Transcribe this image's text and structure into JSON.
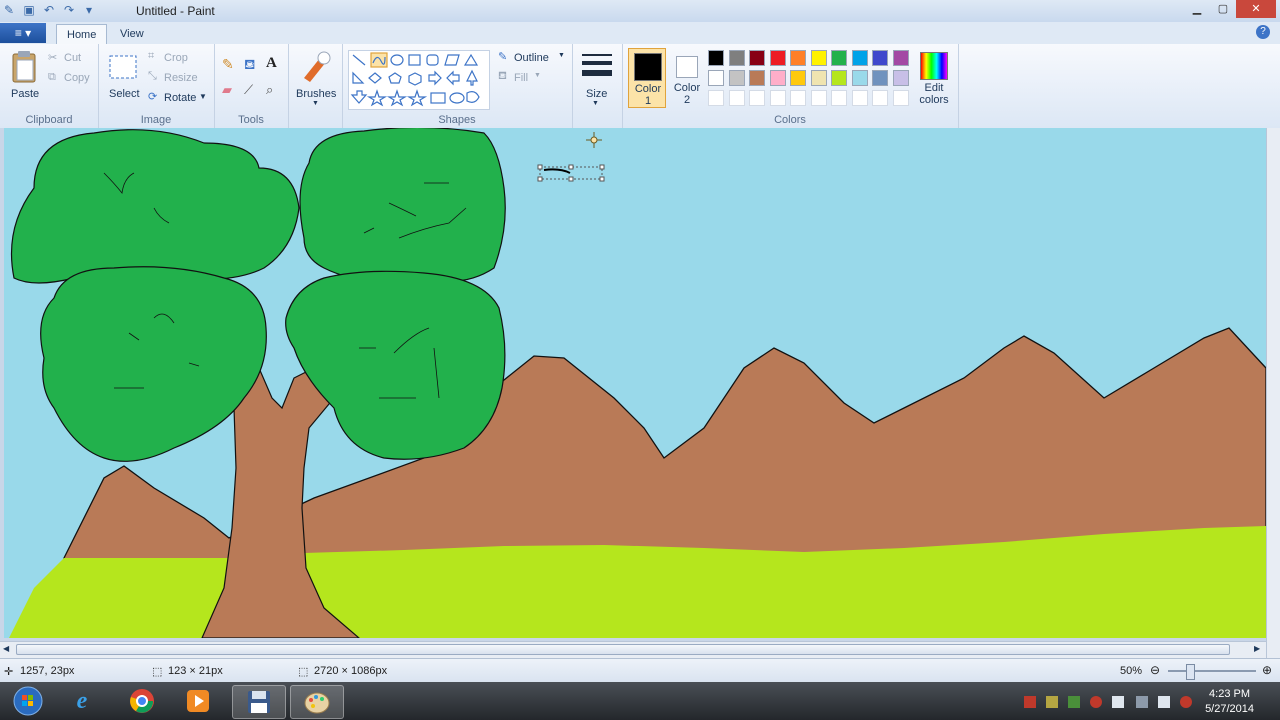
{
  "window": {
    "title": "Untitled - Paint",
    "controls": [
      "minimize",
      "maximize",
      "close"
    ]
  },
  "quick_access": [
    "save-icon",
    "undo-icon",
    "redo-icon",
    "customize-icon"
  ],
  "tabs": {
    "app_menu": "≡ ▾",
    "items": [
      "Home",
      "View"
    ],
    "active": "Home"
  },
  "ribbon": {
    "clipboard": {
      "label": "Clipboard",
      "paste": "Paste",
      "cut": "Cut",
      "copy": "Copy"
    },
    "image": {
      "label": "Image",
      "select": "Select",
      "crop": "Crop",
      "resize": "Resize",
      "rotate": "Rotate"
    },
    "tools": {
      "label": "Tools"
    },
    "brushes": {
      "label": "Brushes"
    },
    "shapes": {
      "label": "Shapes",
      "outline": "Outline",
      "fill": "Fill"
    },
    "size": {
      "label": "Size"
    },
    "colors": {
      "label": "Colors",
      "color1": "Color 1",
      "color2": "Color 2",
      "edit": "Edit colors",
      "color1_value": "#000000",
      "color2_value": "#ffffff",
      "palette_row1": [
        "#000000",
        "#7f7f7f",
        "#880015",
        "#ed1c24",
        "#ff7f27",
        "#fff200",
        "#22b14c",
        "#00a2e8",
        "#3f48cc",
        "#a349a4"
      ],
      "palette_row2": [
        "#ffffff",
        "#c3c3c3",
        "#b97a57",
        "#ffaec9",
        "#ffc90e",
        "#efe4b0",
        "#b5e61d",
        "#99d9ea",
        "#7092be",
        "#c8bfe7"
      ]
    }
  },
  "canvas": {
    "sky": "#99d9ea",
    "grass": "#b5e61d",
    "mountains": "#b97a57",
    "foliage": "#22b14c"
  },
  "status": {
    "cursor_pos": "1257, 23px",
    "selection_size": "123 × 21px",
    "image_size": "2720 × 1086px",
    "zoom": "50%"
  },
  "taskbar": {
    "apps": [
      "start-orb",
      "internet-explorer",
      "chrome",
      "media-player",
      "save-app",
      "paint"
    ],
    "time": "4:23 PM",
    "date": "5/27/2014"
  }
}
